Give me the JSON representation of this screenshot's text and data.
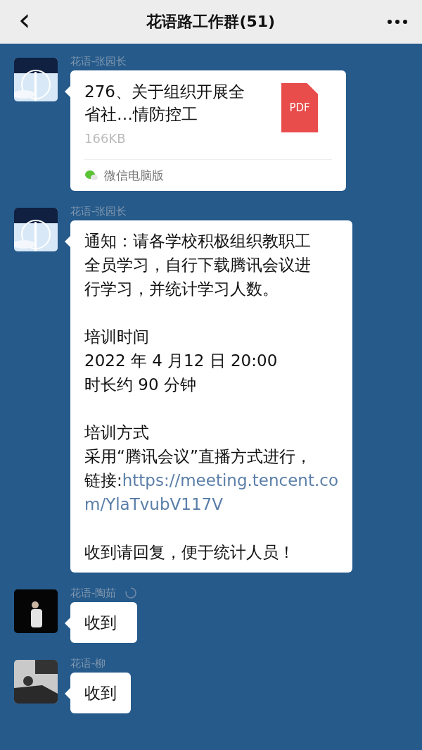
{
  "header": {
    "back": "‹",
    "title": "花语路工作群(51)"
  },
  "messages": [
    {
      "kind": "file",
      "sender": "花语-张园长",
      "file_name": "276、关于组织开展全省社…情防控工",
      "file_type": "PDF",
      "size": "166KB",
      "source": "微信电脑版"
    },
    {
      "kind": "text",
      "sender": "花语-张园长",
      "paragraphs": [
        {
          "lines": [
            {
              "text": "通知：请各学校积极组织教职工"
            },
            {
              "text": "全员学习，自行下载腾讯会议进"
            },
            {
              "text": "行学习，并统计学习人数。"
            }
          ]
        },
        {
          "lines": [
            {
              "text": "培训时间"
            },
            {
              "text": "2022 年 4 月12 日 20:00"
            },
            {
              "text": "时长约 90 分钟"
            }
          ]
        },
        {
          "lines": [
            {
              "text": "培训方式"
            },
            {
              "text": "采用“腾讯会议”直播方式进行，"
            },
            {
              "text": "链接:",
              "link": "https://meeting.tencent.co"
            },
            {
              "link": "m/YlaTvubV117V"
            }
          ]
        },
        {
          "lines": [
            {
              "text": "收到请回复，便于统计人员！"
            }
          ]
        }
      ]
    },
    {
      "kind": "text",
      "sender": "花语-陶茹",
      "pending": true,
      "paragraphs": [
        {
          "lines": [
            {
              "text": "收到"
            }
          ]
        }
      ]
    },
    {
      "kind": "text",
      "sender": "花语-柳",
      "pending": false,
      "paragraphs": [
        {
          "lines": [
            {
              "text": "收到"
            }
          ]
        }
      ]
    }
  ]
}
